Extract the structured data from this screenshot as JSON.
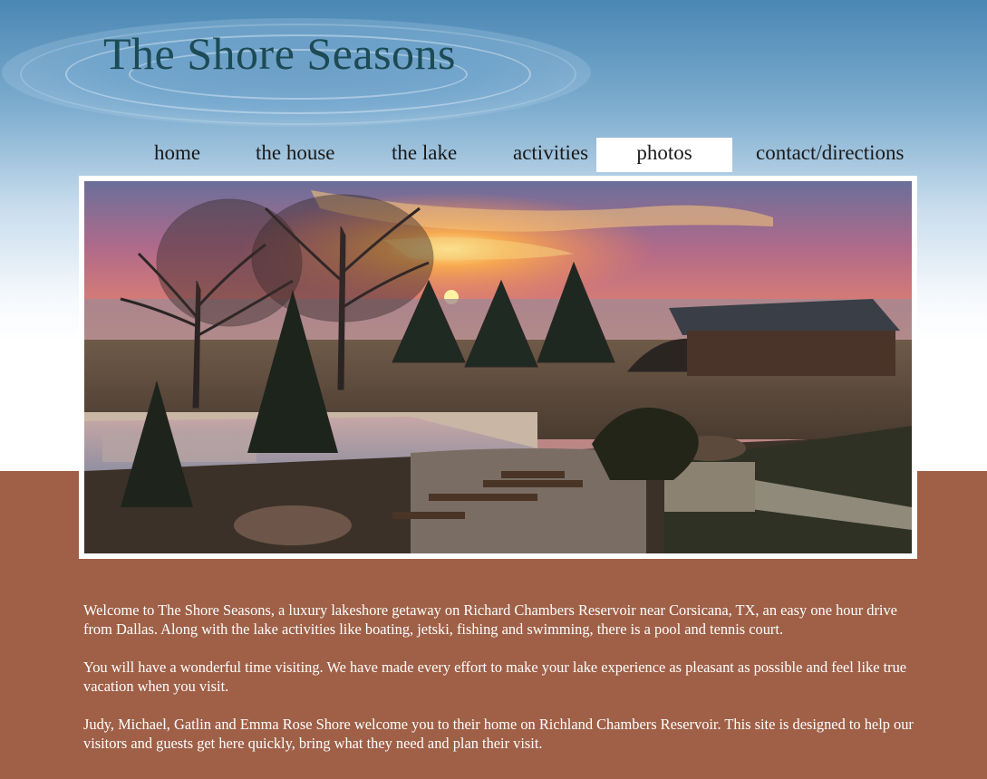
{
  "site": {
    "title": "The Shore Seasons"
  },
  "nav": {
    "items": [
      {
        "label": "home"
      },
      {
        "label": "the house"
      },
      {
        "label": "the lake"
      },
      {
        "label": "activities"
      },
      {
        "label": "photos"
      },
      {
        "label": "contact/directions"
      }
    ],
    "active": "photos"
  },
  "hero": {
    "icon": "lakeshore-sunset-photo"
  },
  "content": {
    "paragraphs": [
      "Welcome to The Shore Seasons, a luxury lakeshore getaway on Richard Chambers Reservoir near Corsicana, TX, an easy one hour drive from Dallas. Along with the lake activities like boating, jetski, fishing and swimming, there is a pool and tennis court.",
      "You will have a wonderful time visiting. We have made every effort to make your lake experience as pleasant as possible and feel like true vacation when you visit.",
      "Judy, Michael, Gatlin and Emma Rose Shore welcome you to their home on Richland Chambers Reservoir. This site is designed to help our visitors and guests get here quickly, bring what they need and plan their visit."
    ]
  },
  "colors": {
    "sky_top": "#4a87b4",
    "brown_band": "#9f6047",
    "logo_text": "#1c4b55"
  }
}
